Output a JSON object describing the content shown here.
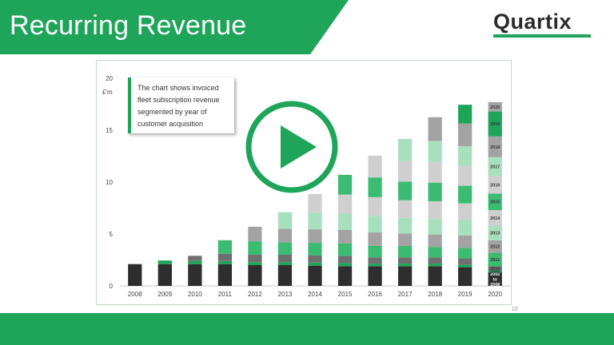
{
  "header": {
    "title": "Recurring Revenue",
    "logo_text": "Quartix"
  },
  "colors": {
    "brand_green": "#1ea55a",
    "dark": "#2e2e2e",
    "grey_dark": "#6f6f6f",
    "grey_mid": "#a3a3a3",
    "grey_light": "#cfcfcf",
    "green_mid": "#3cbb73",
    "green_light": "#a8dfbf"
  },
  "callout": {
    "lines": [
      "The chart shows invoiced",
      "fleet subscription revenue",
      "segmented by year of",
      "customer acquisition"
    ]
  },
  "page_number": "22",
  "player": {
    "icon": "play-icon"
  },
  "chart_data": {
    "type": "bar",
    "stacked": true,
    "ylabel": "£'m",
    "ylim": [
      0,
      20
    ],
    "yticks": [
      0,
      5,
      10,
      15,
      20
    ],
    "grid": false,
    "categories": [
      "2008",
      "2009",
      "2010",
      "2011",
      "2012",
      "2013",
      "2014",
      "2015",
      "2016",
      "2017",
      "2018",
      "2019",
      "2020"
    ],
    "series": [
      {
        "name": "2002 to 2008",
        "color": "#2e2e2e",
        "values": [
          2.1,
          2.1,
          2.1,
          2.1,
          2.0,
          2.0,
          1.95,
          1.9,
          1.9,
          1.9,
          1.9,
          1.8,
          1.3
        ]
      },
      {
        "name": "2009",
        "color": "#1ea55a",
        "values": [
          0,
          0.35,
          0.3,
          0.3,
          0.3,
          0.3,
          0.3,
          0.3,
          0.25,
          0.25,
          0.25,
          0.25,
          0.2
        ]
      },
      {
        "name": "2010",
        "color": "#6f6f6f",
        "values": [
          0,
          0,
          0.5,
          0.7,
          0.7,
          0.7,
          0.7,
          0.7,
          0.6,
          0.6,
          0.6,
          0.6,
          0.4
        ]
      },
      {
        "name": "2011",
        "color": "#3cbb73",
        "values": [
          0,
          0,
          0,
          1.3,
          1.3,
          1.2,
          1.2,
          1.2,
          1.1,
          1.1,
          1.0,
          1.0,
          1.3
        ]
      },
      {
        "name": "2012",
        "color": "#a3a3a3",
        "values": [
          0,
          0,
          0,
          0,
          1.4,
          1.3,
          1.3,
          1.3,
          1.3,
          1.2,
          1.2,
          1.2,
          1.2
        ]
      },
      {
        "name": "2013",
        "color": "#a8dfbf",
        "values": [
          0,
          0,
          0,
          0,
          0,
          1.6,
          1.6,
          1.6,
          1.6,
          1.5,
          1.5,
          1.5,
          1.4
        ]
      },
      {
        "name": "2014",
        "color": "#cfcfcf",
        "values": [
          0,
          0,
          0,
          0,
          0,
          0,
          1.8,
          1.8,
          1.8,
          1.7,
          1.7,
          1.6,
          1.5
        ]
      },
      {
        "name": "2015",
        "color": "#3cbb73",
        "values": [
          0,
          0,
          0,
          0,
          0,
          0,
          0,
          1.9,
          1.9,
          1.8,
          1.8,
          1.7,
          1.6
        ]
      },
      {
        "name": "2016",
        "color": "#cfcfcf",
        "values": [
          0,
          0,
          0,
          0,
          0,
          0,
          0,
          0,
          2.1,
          2.0,
          2.0,
          1.9,
          1.7
        ]
      },
      {
        "name": "2017",
        "color": "#a8dfbf",
        "values": [
          0,
          0,
          0,
          0,
          0,
          0,
          0,
          0,
          0,
          2.1,
          2.0,
          1.9,
          1.8
        ]
      },
      {
        "name": "2018",
        "color": "#a3a3a3",
        "values": [
          0,
          0,
          0,
          0,
          0,
          0,
          0,
          0,
          0,
          0,
          2.3,
          2.2,
          2.0
        ]
      },
      {
        "name": "2019",
        "color": "#1ea55a",
        "values": [
          0,
          0,
          0,
          0,
          0,
          0,
          0,
          0,
          0,
          0,
          0,
          1.8,
          2.4
        ]
      },
      {
        "name": "2020",
        "color": "#a3a3a3",
        "values": [
          0,
          0,
          0,
          0,
          0,
          0,
          0,
          0,
          0,
          0,
          0,
          0,
          0.9
        ]
      }
    ],
    "segment_labels_category": "2020",
    "segment_label_lines": {
      "2002 to 2008": [
        "2002",
        "to",
        "2008"
      ]
    }
  }
}
